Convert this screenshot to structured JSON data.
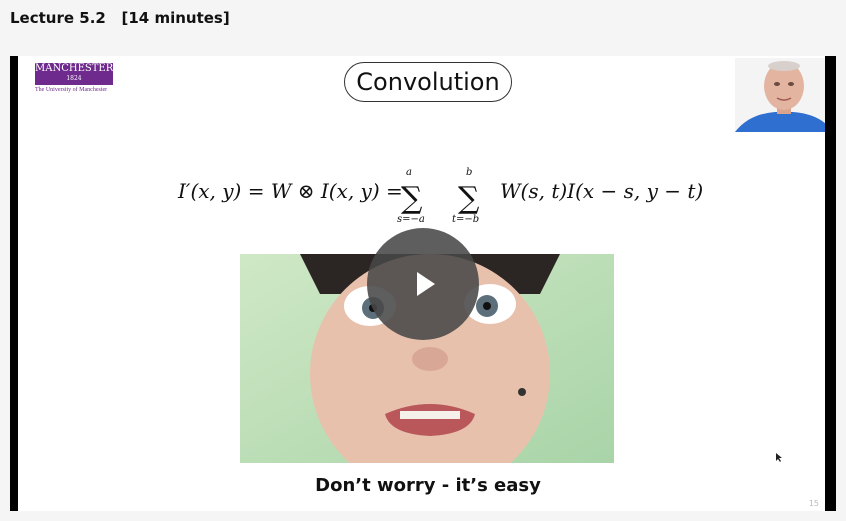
{
  "header": {
    "title": "Lecture 5.2   [14 minutes]"
  },
  "slide": {
    "logo_text": "MANCHESTER",
    "logo_year": "1824",
    "logo_tagline": "The University of Manchester",
    "title": "Convolution",
    "formula": {
      "lhs": "I′(x, y) = W ⊗ I(x, y) =",
      "sum1_upper": "a",
      "sum1_lower": "s=−a",
      "sum2_upper": "b",
      "sum2_lower": "t=−b",
      "rhs": "W(s, t)I(x − s, y − t)"
    },
    "caption": "Don’t worry - it’s easy",
    "page_number": "15"
  },
  "player": {
    "play_icon": "play-icon"
  },
  "colors": {
    "brand": "#6e2a8d",
    "player_bg": "#000000",
    "play_button": "#484848"
  }
}
